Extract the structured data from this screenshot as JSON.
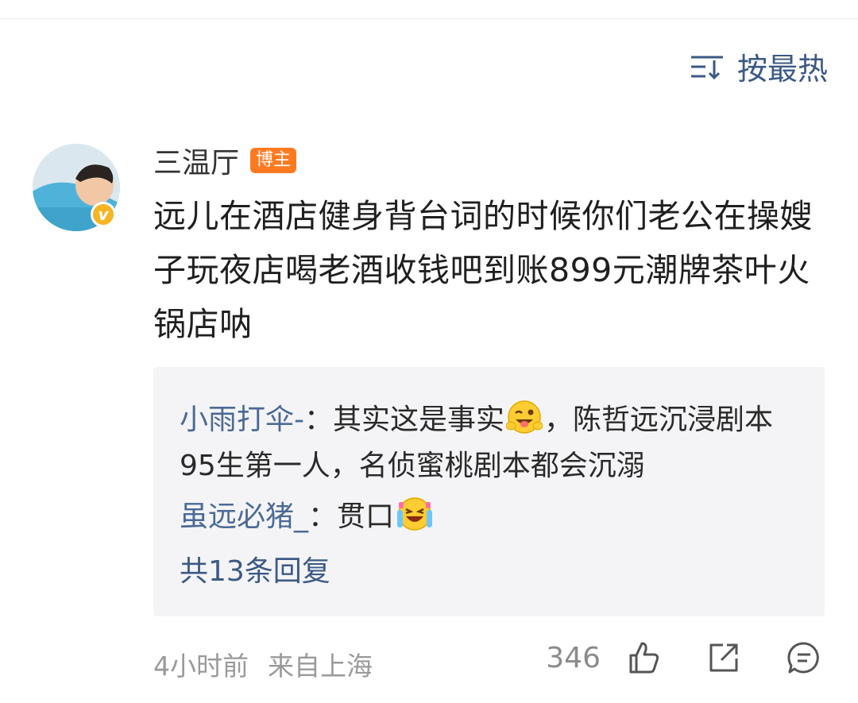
{
  "sort": {
    "label": "按最热",
    "icon": "sort-icon"
  },
  "comment": {
    "username": "三温厅",
    "tag": "博主",
    "verified_badge": "v",
    "text": "远儿在酒店健身背台词的时候你们老公在操嫂子玩夜店喝老酒收钱吧到账899元潮牌茶叶火锅店呐"
  },
  "replies": [
    {
      "author": "小雨打伞-",
      "separator": "：",
      "text_before": "其实这是事实",
      "emoji": "wink-tongue-emoji",
      "text_after": "，陈哲远沉浸剧本95生第一人，名侦蜜桃剧本都会沉溺"
    },
    {
      "author": "虽远必猪_",
      "separator": "：",
      "text_before": "贯口",
      "emoji": "laughing-tears-emoji",
      "text_after": ""
    }
  ],
  "more_replies": "共13条回复",
  "footer": {
    "time": "4小时前",
    "location": "来自上海",
    "like_count": "346"
  },
  "colors": {
    "link_blue": "#3b5a85",
    "badge_orange": "#ff7a1f",
    "verified_gold": "#f5b523",
    "reply_bg": "#f4f4f6"
  }
}
